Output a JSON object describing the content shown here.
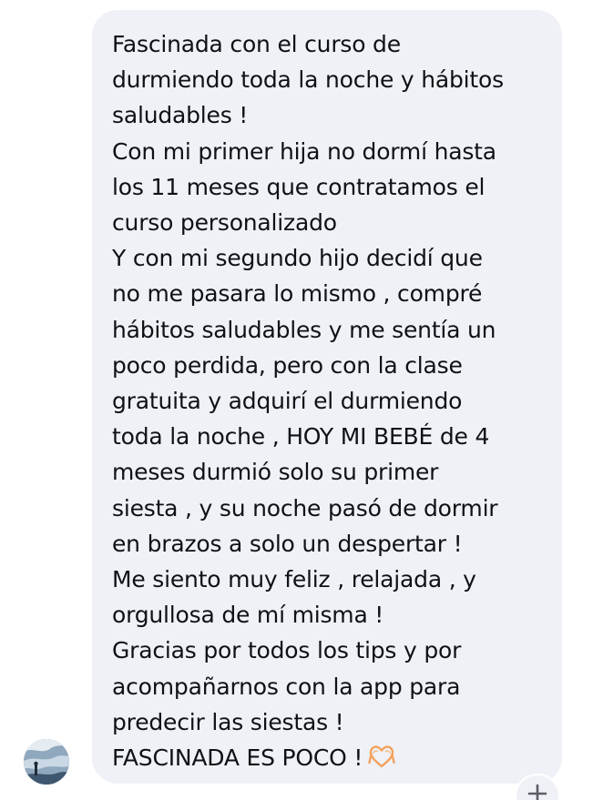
{
  "message": {
    "lines": [
      "Fascinada con el curso de",
      "durmiendo toda la noche y hábitos",
      "saludables !",
      "Con mi primer hija no dormí hasta",
      "los 11 meses que contratamos el",
      "curso personalizado",
      "Y con mi segundo hijo decidí que",
      "no me pasara lo mismo , compré",
      "hábitos saludables y me sentía un",
      "poco perdida, pero con la clase",
      "gratuita y adquirí el durmiendo",
      "toda la noche , HOY MI BEBÉ de 4",
      "meses durmió solo su primer",
      "siesta , y su noche pasó de dormir",
      "en brazos a solo un despertar !",
      "Me siento muy feliz , relajada , y",
      "orgullosa de mí misma !",
      "Gracias por todos los tips y por",
      "acompañarnos con la app para",
      "predecir las siestas !",
      "FASCINADA ES POCO !"
    ],
    "final_emoji": "heart-hands-icon"
  },
  "sender": {
    "avatar": "profile-photo"
  },
  "reaction_button": {
    "icon": "add-reaction-icon"
  },
  "colors": {
    "bubble": "#eff1f6",
    "text": "#0f1114",
    "emoji": "#f2a35e"
  }
}
